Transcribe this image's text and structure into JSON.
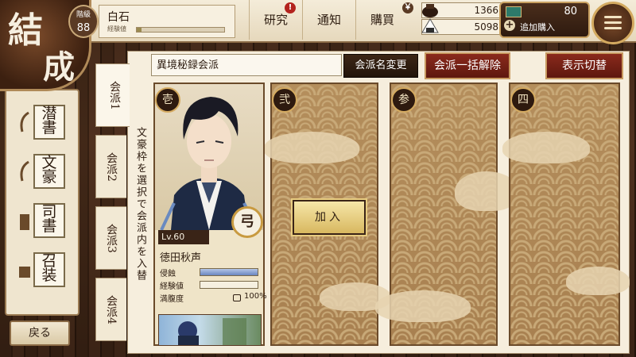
{
  "header": {
    "title_chars": [
      "結",
      "成"
    ],
    "rank_label": "階級",
    "rank_value": "88",
    "player_name": "白石",
    "xp_label": "経験値",
    "xp_progress": 0.05,
    "nav": [
      {
        "label": "研究",
        "badge": "!"
      },
      {
        "label": "通知",
        "badge": ""
      },
      {
        "label": "購買",
        "badge": "￥"
      }
    ],
    "resources": {
      "ink": "1366",
      "food": "5098"
    },
    "currency_value": "80",
    "buy_more_label": "追加購入"
  },
  "sidebar": {
    "items": [
      {
        "char1": "潜",
        "char2": "書"
      },
      {
        "char1": "文",
        "char2": "豪"
      },
      {
        "char1": "司",
        "char2": "書"
      },
      {
        "char1": "召",
        "char2": "装"
      }
    ],
    "back_label": "戻る"
  },
  "tabs": [
    {
      "label": "会派1"
    },
    {
      "label": "会派2"
    },
    {
      "label": "会派3"
    },
    {
      "label": "会派4"
    }
  ],
  "hint": "文豪枠を選択で会派内を入替",
  "faction": {
    "name_value": "異境秘録会派",
    "rename_label": "会派名変更",
    "disband_label": "会派一括解除",
    "toggle_view_label": "表示切替"
  },
  "slots": [
    {
      "num": "壱"
    },
    {
      "num": "弐"
    },
    {
      "num": "参"
    },
    {
      "num": "四"
    }
  ],
  "join_label": "加入",
  "character": {
    "level": "Lv.60",
    "weapon": "弓",
    "name": "徳田秋声",
    "erosion_label": "侵蝕",
    "erosion": 1.0,
    "exp_label": "経験値",
    "exp": 0.0,
    "satiety_label": "満腹度",
    "satiety_value": "100%"
  }
}
